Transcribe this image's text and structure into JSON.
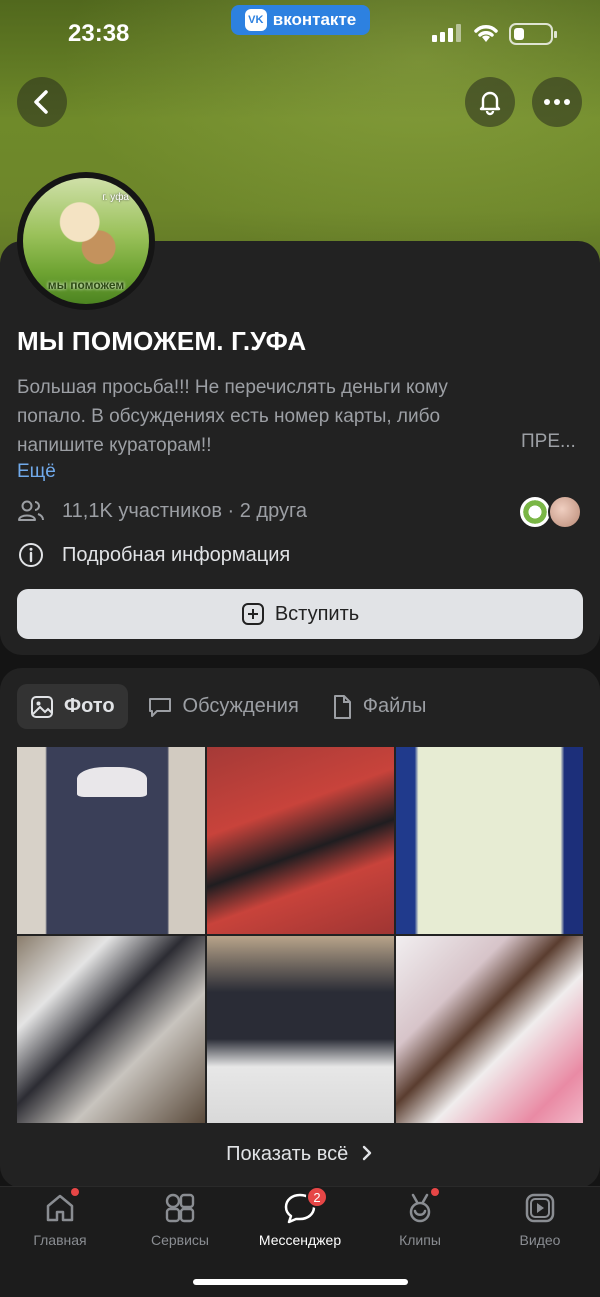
{
  "status_bar": {
    "time": "23:38",
    "app_pill": "вконтакте",
    "app_logo": "VK"
  },
  "header": {
    "back_icon": "chevron-left-icon",
    "bell_icon": "bell-icon",
    "more_icon": "more-icon"
  },
  "community": {
    "avatar_top_text": "г. уфа",
    "avatar_bottom_text": "мы поможем",
    "name": "МЫ ПОМОЖЕМ. Г.УФА",
    "description": "Большая просьба!!! Не перечислять деньги кому попало. В обсуждениях есть номер карты, либо напишите кураторам!!",
    "truncated_suffix": "ПРЕ...",
    "more_label": "Ещё",
    "members_text": "11,1K участников · 2 друга",
    "info_text": "Подробная информация",
    "join_label": "Вступить"
  },
  "content_tabs": [
    {
      "label": "Фото",
      "icon": "image-icon",
      "active": true
    },
    {
      "label": "Обсуждения",
      "icon": "chat-icon",
      "active": false
    },
    {
      "label": "Файлы",
      "icon": "file-icon",
      "active": false
    }
  ],
  "photos_count_visible": 6,
  "show_all_label": "Показать всё",
  "tabbar": [
    {
      "label": "Главная",
      "icon": "home-icon",
      "dot": true
    },
    {
      "label": "Сервисы",
      "icon": "services-icon",
      "dot": false
    },
    {
      "label": "Мессенджер",
      "icon": "messenger-icon",
      "badge": "2",
      "active": true
    },
    {
      "label": "Клипы",
      "icon": "clips-icon",
      "dot": true
    },
    {
      "label": "Видео",
      "icon": "video-icon",
      "dot": false
    }
  ],
  "colors": {
    "accent_link": "#71aaeb",
    "badge": "#e64646",
    "vk_blue": "#2d81e0",
    "card_bg": "#222222"
  }
}
